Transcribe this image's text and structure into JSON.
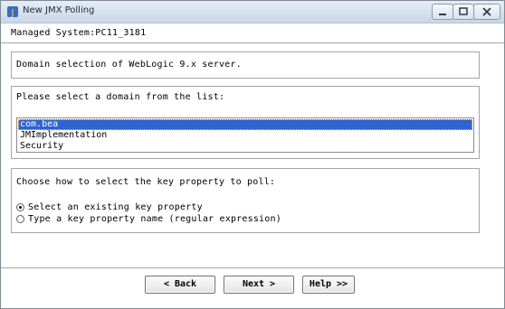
{
  "window": {
    "title": "New JMX Polling",
    "controls": {
      "minimize": "minimize",
      "maximize": "maximize",
      "close": "close"
    }
  },
  "managed_system": "Managed System:PC11_3181",
  "domain_info": "Domain selection of WebLogic 9.x server.",
  "domain_list": {
    "prompt": "Please select a domain from the list:",
    "items": [
      "com.bea",
      "JMImplementation",
      "Security"
    ],
    "selected_index": 0
  },
  "key_property": {
    "prompt": "Choose how to select the key property to poll:",
    "options": [
      {
        "label": "Select an existing key property",
        "checked": true
      },
      {
        "label": "Type a key property name (regular expression)",
        "checked": false
      }
    ]
  },
  "buttons": {
    "back": "< Back",
    "next": "Next >",
    "help": "Help >>"
  }
}
